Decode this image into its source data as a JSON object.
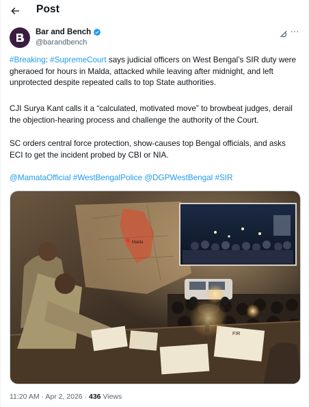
{
  "header": {
    "title": "Post",
    "back_icon": "arrow-left-icon"
  },
  "author": {
    "name": "Bar and Bench",
    "handle": "@barandbench",
    "verified_color": "#1d9bf0",
    "avatar_color": "#3b1d40"
  },
  "post": {
    "para1": {
      "tag1": "#Breaking",
      "sep": ": ",
      "tag2": "#SupremeCourt",
      "text": " says judicial officers on West Bengal’s SIR duty were gheraoed for hours in Malda, attacked while leaving after midnight, and left unprotected despite repeated calls to top State authorities."
    },
    "para2": "CJI Surya Kant calls it a “calculated, motivated move” to browbeat judges, derail the objection-hearing process and challenge the authority of the Court.",
    "para3": "SC orders central force protection, show-causes top Bengal officials, and asks ECI to get the incident probed by CBI or NIA.",
    "hashtags": [
      "@MamataOfficial",
      "#WestBengalPolice",
      "@DGPWestBengal",
      "#SIR"
    ]
  },
  "media": {
    "map_label": "Malda",
    "paper_label": "FIR"
  },
  "meta": {
    "time": "11:20 AM",
    "dot": " · ",
    "date": "Apr 2, 2026",
    "views_count": "436",
    "views_label": " Views"
  },
  "colors": {
    "link": "#1d9bf0",
    "muted": "#536471",
    "text": "#0f1419"
  }
}
